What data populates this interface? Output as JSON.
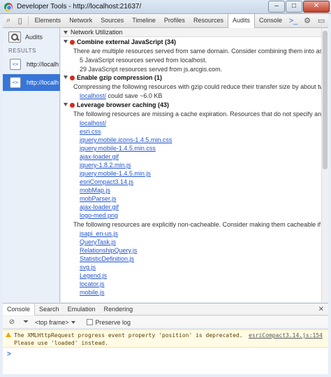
{
  "window": {
    "title": "Developer Tools - http://localhost:21637/",
    "min_label": "–",
    "max_label": "□",
    "close_label": "✕"
  },
  "tabs": [
    "Elements",
    "Network",
    "Sources",
    "Timeline",
    "Profiles",
    "Resources",
    "Audits",
    "Console"
  ],
  "active_tab": "Audits",
  "sidebar": {
    "audits_label": "Audits",
    "results_header": "RESULTS",
    "results": [
      "http://localh",
      "http://localh"
    ]
  },
  "main": {
    "section_title": "Network Utilization",
    "rules": [
      {
        "title": "Combine external JavaScript (34)",
        "description": "There are multiple resources served from same domain. Consider combining them into as few ...",
        "lines": [
          "5 JavaScript resources served from localhost.",
          "29 JavaScript resources served from js.arcgis.com."
        ]
      },
      {
        "title": "Enable gzip compression (1)",
        "description": "Compressing the following resources with gzip could reduce their transfer size by about two t...",
        "link": "localhost/",
        "link_suffix": "could save ~6.0 KB"
      },
      {
        "title": "Leverage browser caching (43)",
        "description": "The following resources are missing a cache expiration. Resources that do not specify an expir...",
        "links": [
          "localhost/",
          "esri.css",
          "jquery.mobile.icons-1.4.5.min.css",
          "jquery.mobile-1.4.5.min.css",
          "ajax-loader.gif",
          "jquery-1.8.2.min.js",
          "jquery.mobile-1.4.5.min.js",
          "esriCompact3.14.js",
          "mobMap.js",
          "mobParser.js",
          "ajax-loader.gif",
          "logo-med.png"
        ],
        "description2": "The following resources are explicitly non-cacheable. Consider making them cacheable if possi...",
        "links2": [
          "jsapi_en-us.js",
          "QueryTask.js",
          "RelationshipQuery.js",
          "StatisticDefinition.js",
          "svg.js",
          "Legend.js",
          "locator.js",
          "mobile.js"
        ]
      }
    ]
  },
  "drawer": {
    "tabs": [
      "Console",
      "Search",
      "Emulation",
      "Rendering"
    ],
    "close_label": "✕",
    "frame_select": "<top frame>",
    "preserve_log": "Preserve log",
    "warning_line1": "The XMLHttpRequest progress event property 'position' is deprecated.",
    "warning_line2": "Please use 'loaded' instead.",
    "warning_source": "esriCompact3.14.js:154",
    "prompt": ">"
  }
}
